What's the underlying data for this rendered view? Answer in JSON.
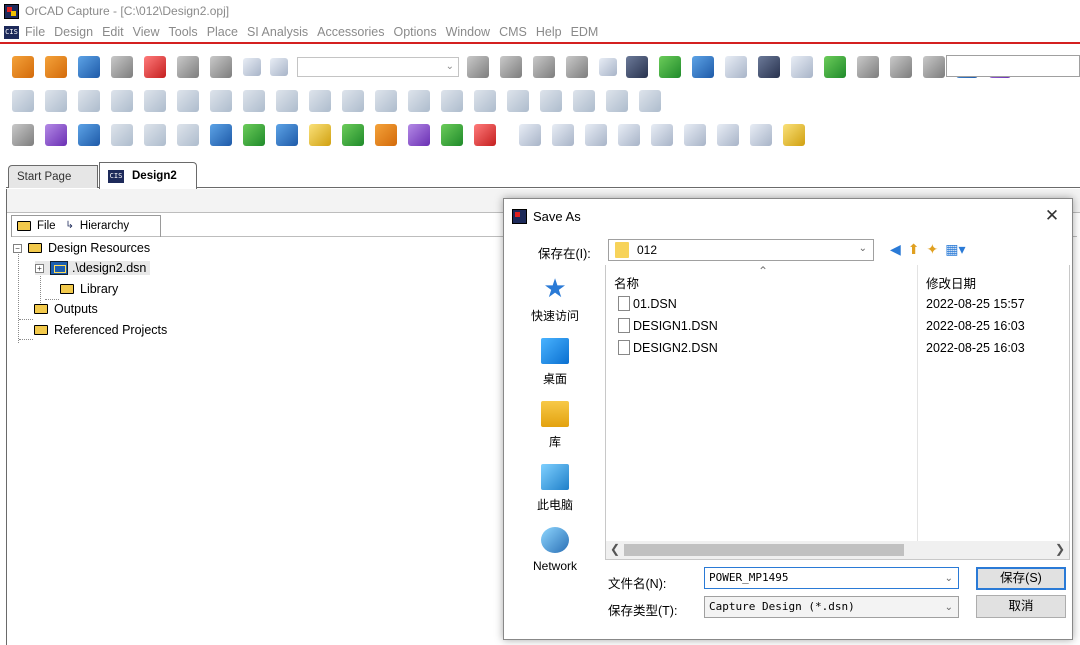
{
  "window": {
    "title": "OrCAD Capture - [C:\\012\\Design2.opj]"
  },
  "menubar": {
    "icon": "app-menu-icon",
    "items": [
      "File",
      "Design",
      "Edit",
      "View",
      "Tools",
      "Place",
      "SI Analysis",
      "Accessories",
      "Options",
      "Window",
      "CMS",
      "Help",
      "EDM"
    ]
  },
  "tabs": {
    "start_page": "Start Page",
    "design2": "Design2"
  },
  "project": {
    "subtabs": {
      "file": "File",
      "hierarchy": "Hierarchy"
    },
    "tree": {
      "design_resources": "Design Resources",
      "dsn": ".\\design2.dsn",
      "library": "Library",
      "outputs": "Outputs",
      "referenced_projects": "Referenced Projects"
    }
  },
  "dialog": {
    "title": "Save As",
    "save_in_label": "保存在(I):",
    "save_in_value": "012",
    "places": [
      {
        "label": "快速访问",
        "icon": "star-icon"
      },
      {
        "label": "桌面",
        "icon": "desktop-icon"
      },
      {
        "label": "库",
        "icon": "library-icon"
      },
      {
        "label": "此电脑",
        "icon": "computer-icon"
      },
      {
        "label": "Network",
        "icon": "network-icon"
      }
    ],
    "columns": {
      "name": "名称",
      "date": "修改日期"
    },
    "files": [
      {
        "name": "01.DSN",
        "date": "2022-08-25 15:57"
      },
      {
        "name": "DESIGN1.DSN",
        "date": "2022-08-25 16:03"
      },
      {
        "name": "DESIGN2.DSN",
        "date": "2022-08-25 16:03"
      }
    ],
    "file_name_label": "文件名(N):",
    "file_name_value": "POWER_MP1495",
    "file_type_label": "保存类型(T):",
    "file_type_value": "Capture Design (*.dsn)",
    "save_button": "保存(S)",
    "cancel_button": "取消"
  }
}
